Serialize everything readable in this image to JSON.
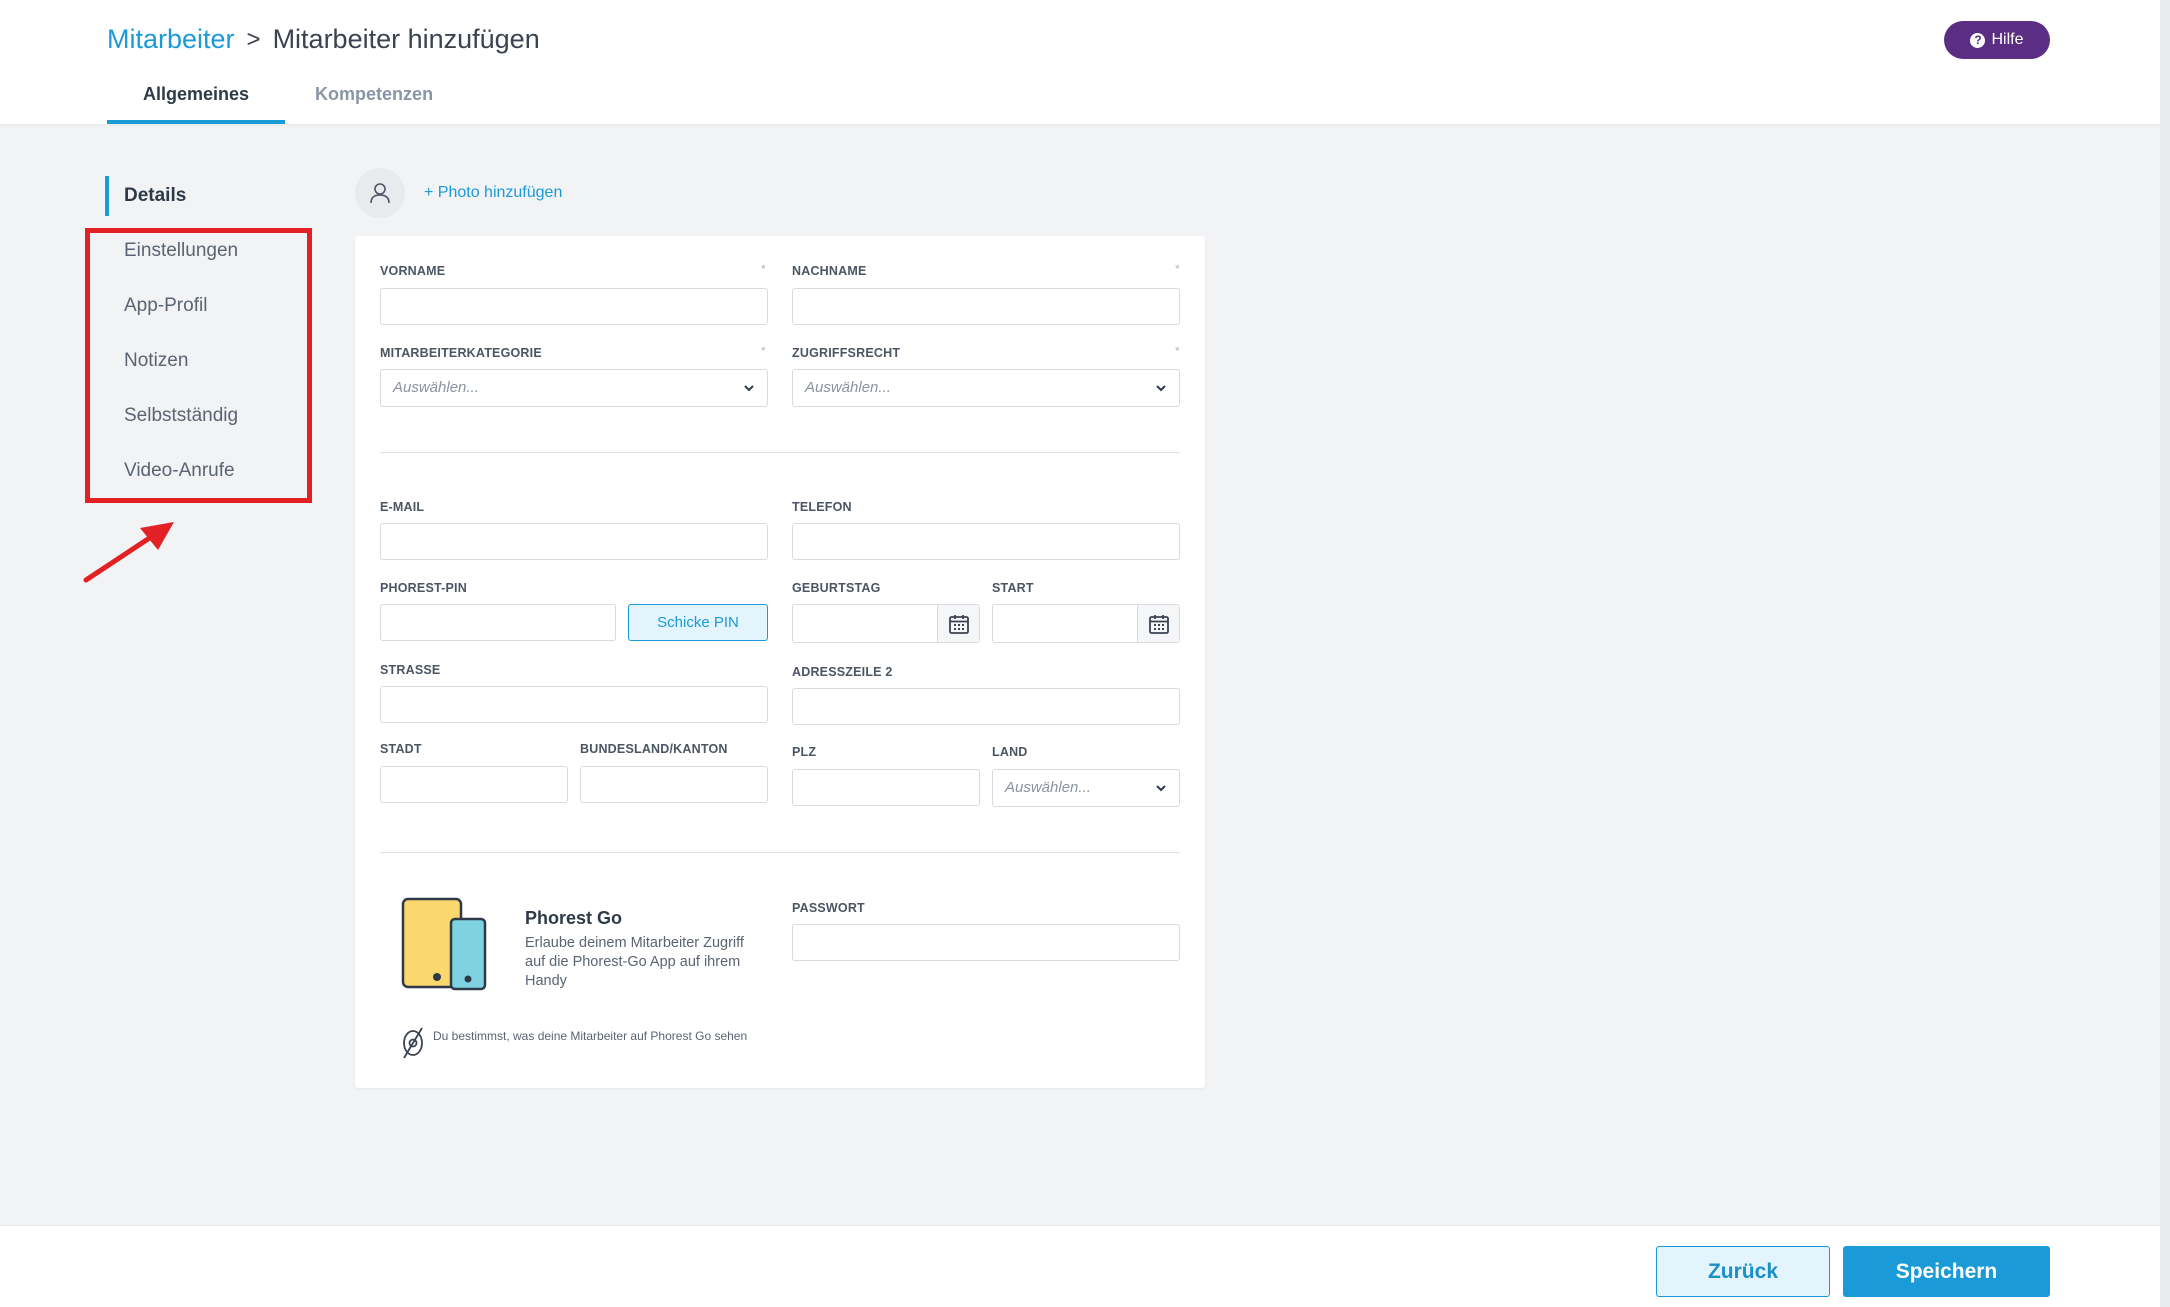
{
  "header": {
    "breadcrumb_parent": "Mitarbeiter",
    "breadcrumb_separator": ">",
    "breadcrumb_current": "Mitarbeiter hinzufügen",
    "help_label": "Hilfe",
    "tabs": [
      {
        "label": "Allgemeines",
        "active": true
      },
      {
        "label": "Kompetenzen",
        "active": false
      }
    ]
  },
  "sidebar": {
    "items": [
      {
        "label": "Details",
        "active": true
      },
      {
        "label": "Einstellungen"
      },
      {
        "label": "App-Profil"
      },
      {
        "label": "Notizen"
      },
      {
        "label": "Selbstständig"
      },
      {
        "label": "Video-Anrufe"
      }
    ]
  },
  "photo": {
    "add_label": "+ Photo hinzufügen"
  },
  "form": {
    "required_mark": "*",
    "vorname": {
      "label": "VORNAME",
      "value": ""
    },
    "nachname": {
      "label": "NACHNAME",
      "value": ""
    },
    "mitarbeiterkategorie": {
      "label": "MITARBEITERKATEGORIE",
      "placeholder": "Auswählen..."
    },
    "zugriffsrecht": {
      "label": "ZUGRIFFSRECHT",
      "placeholder": "Auswählen..."
    },
    "email": {
      "label": "E-MAIL",
      "value": ""
    },
    "telefon": {
      "label": "TELEFON",
      "value": ""
    },
    "pin": {
      "label": "PHOREST-PIN",
      "value": "",
      "button": "Schicke PIN"
    },
    "geburtstag": {
      "label": "GEBURTSTAG",
      "value": ""
    },
    "start": {
      "label": "START",
      "value": ""
    },
    "strasse": {
      "label": "STRASSE",
      "value": ""
    },
    "adresszeile2": {
      "label": "ADRESSZEILE 2",
      "value": ""
    },
    "stadt": {
      "label": "STADT",
      "value": ""
    },
    "bundesland": {
      "label": "BUNDESLAND/KANTON",
      "value": ""
    },
    "plz": {
      "label": "PLZ",
      "value": ""
    },
    "land": {
      "label": "LAND",
      "placeholder": "Auswählen..."
    },
    "passwort": {
      "label": "PASSWORT",
      "value": ""
    }
  },
  "phorest_go": {
    "title": "Phorest Go",
    "description": "Erlaube deinem Mitarbeiter Zugriff auf die Phorest-Go App auf ihrem Handy",
    "note": "Du bestimmst, was deine Mitarbeiter auf Phorest Go sehen"
  },
  "footer": {
    "back_label": "Zurück",
    "save_label": "Speichern"
  },
  "colors": {
    "accent": "#1a9ad6",
    "help": "#5b2d83",
    "annotation": "#e32024"
  },
  "icons": [
    "chevron-right-icon",
    "question-icon",
    "user-icon",
    "chevron-down-icon",
    "calendar-icon",
    "phone-icon",
    "eye-off-icon",
    "arrow-annotation"
  ]
}
